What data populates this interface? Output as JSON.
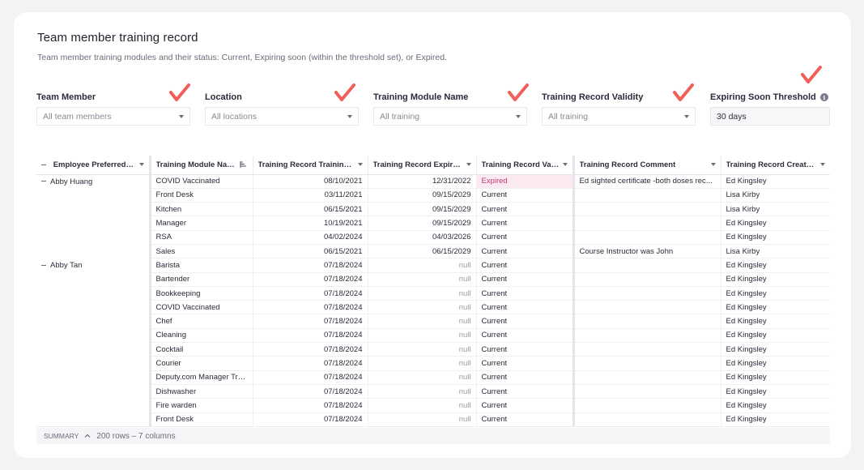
{
  "page": {
    "title": "Team member training record",
    "subtitle": "Team member training modules and their status: Current, Expiring soon (within the threshold set), or Expired."
  },
  "filters": [
    {
      "label": "Team Member",
      "value": "All team members",
      "type": "select"
    },
    {
      "label": "Location",
      "value": "All locations",
      "type": "select"
    },
    {
      "label": "Training Module Name",
      "value": "All training",
      "type": "select"
    },
    {
      "label": "Training Record Validity",
      "value": "All training",
      "type": "select"
    },
    {
      "label": "Expiring Soon Threshold",
      "value": "30 days",
      "type": "input",
      "info_icon": "info-icon"
    }
  ],
  "colors": {
    "accent_check": "#f0605a",
    "expired_bg": "#fbeaf1",
    "expired_text": "#c33b6e"
  },
  "table": {
    "columns": [
      "Employee Preferred N...",
      "Training Module Name",
      "Training Record Training ...",
      "Training Record Expiry ...",
      "Training Record Vali...",
      "Training Record Comment",
      "Training Record Create..."
    ],
    "groups": [
      {
        "employee": "Abby Huang",
        "rows": [
          {
            "module": "COVID Vaccinated",
            "training": "08/10/2021",
            "expiry": "12/31/2022",
            "validity": "Expired",
            "comment": "Ed sighted certificate -both doses rec...",
            "created": "Ed Kingsley"
          },
          {
            "module": "Front Desk",
            "training": "03/11/2021",
            "expiry": "09/15/2029",
            "validity": "Current",
            "comment": "",
            "created": "Lisa Kirby"
          },
          {
            "module": "Kitchen",
            "training": "06/15/2021",
            "expiry": "09/15/2029",
            "validity": "Current",
            "comment": "",
            "created": "Lisa Kirby"
          },
          {
            "module": "Manager",
            "training": "10/19/2021",
            "expiry": "09/15/2029",
            "validity": "Current",
            "comment": "",
            "created": "Ed Kingsley"
          },
          {
            "module": "RSA",
            "training": "04/02/2024",
            "expiry": "04/03/2026",
            "validity": "Current",
            "comment": "",
            "created": "Ed Kingsley"
          },
          {
            "module": "Sales",
            "training": "06/15/2021",
            "expiry": "06/15/2029",
            "validity": "Current",
            "comment": "Course Instructor was John",
            "created": "Lisa Kirby"
          }
        ]
      },
      {
        "employee": "Abby Tan",
        "rows": [
          {
            "module": "Barista",
            "training": "07/18/2024",
            "expiry": "null",
            "validity": "Current",
            "comment": "",
            "created": "Ed Kingsley"
          },
          {
            "module": "Bartender",
            "training": "07/18/2024",
            "expiry": "null",
            "validity": "Current",
            "comment": "",
            "created": "Ed Kingsley"
          },
          {
            "module": "Bookkeeping",
            "training": "07/18/2024",
            "expiry": "null",
            "validity": "Current",
            "comment": "",
            "created": "Ed Kingsley"
          },
          {
            "module": "COVID Vaccinated",
            "training": "07/18/2024",
            "expiry": "null",
            "validity": "Current",
            "comment": "",
            "created": "Ed Kingsley"
          },
          {
            "module": "Chef",
            "training": "07/18/2024",
            "expiry": "null",
            "validity": "Current",
            "comment": "",
            "created": "Ed Kingsley"
          },
          {
            "module": "Cleaning",
            "training": "07/18/2024",
            "expiry": "null",
            "validity": "Current",
            "comment": "",
            "created": "Ed Kingsley"
          },
          {
            "module": "Cocktail",
            "training": "07/18/2024",
            "expiry": "null",
            "validity": "Current",
            "comment": "",
            "created": "Ed Kingsley"
          },
          {
            "module": "Courier",
            "training": "07/18/2024",
            "expiry": "null",
            "validity": "Current",
            "comment": "",
            "created": "Ed Kingsley"
          },
          {
            "module": "Deputy.com Manager Trai...",
            "training": "07/18/2024",
            "expiry": "null",
            "validity": "Current",
            "comment": "",
            "created": "Ed Kingsley"
          },
          {
            "module": "Dishwasher",
            "training": "07/18/2024",
            "expiry": "null",
            "validity": "Current",
            "comment": "",
            "created": "Ed Kingsley"
          },
          {
            "module": "Fire warden",
            "training": "07/18/2024",
            "expiry": "null",
            "validity": "Current",
            "comment": "",
            "created": "Ed Kingsley"
          },
          {
            "module": "Front Desk",
            "training": "07/18/2024",
            "expiry": "null",
            "validity": "Current",
            "comment": "",
            "created": "Ed Kingsley"
          }
        ]
      }
    ]
  },
  "summary": {
    "label": "SUMMARY",
    "count": "200 rows – 7 columns"
  }
}
